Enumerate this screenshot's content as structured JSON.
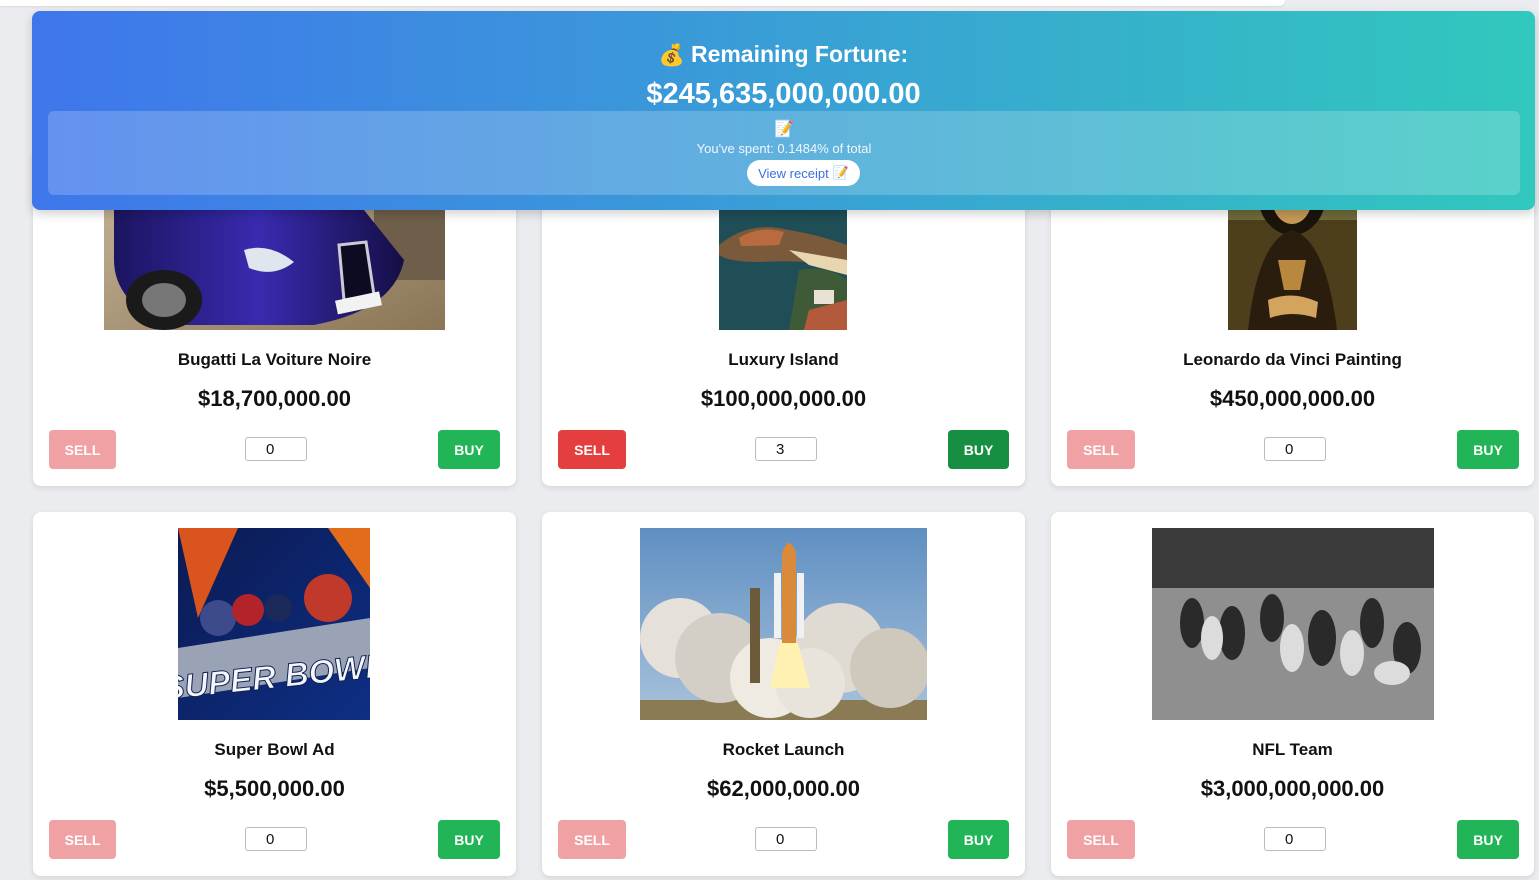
{
  "fortune": {
    "icon": "money-bag-icon",
    "title": "Remaining Fortune:",
    "amount": "$245,635,000,000.00",
    "spent_text": "You've spent: 0.1484% of total",
    "receipt_label": "View receipt"
  },
  "items": [
    {
      "name": "Bugatti La Voiture Noire",
      "price": "$18,700,000.00",
      "quantity": "0",
      "sell_label": "SELL",
      "buy_label": "BUY",
      "image": "bugatti-photo"
    },
    {
      "name": "Luxury Island",
      "price": "$100,000,000.00",
      "quantity": "3",
      "sell_label": "SELL",
      "buy_label": "BUY",
      "image": "island-photo"
    },
    {
      "name": "Leonardo da Vinci Painting",
      "price": "$450,000,000.00",
      "quantity": "0",
      "sell_label": "SELL",
      "buy_label": "BUY",
      "image": "mona-lisa-photo"
    },
    {
      "name": "Super Bowl Ad",
      "price": "$5,500,000.00",
      "quantity": "0",
      "sell_label": "SELL",
      "buy_label": "BUY",
      "image": "super-bowl-photo",
      "logo_text": "SUPER BOWL"
    },
    {
      "name": "Rocket Launch",
      "price": "$62,000,000.00",
      "quantity": "0",
      "sell_label": "SELL",
      "buy_label": "BUY",
      "image": "rocket-photo"
    },
    {
      "name": "NFL Team",
      "price": "$3,000,000,000.00",
      "quantity": "0",
      "sell_label": "SELL",
      "buy_label": "BUY",
      "image": "football-photo"
    }
  ]
}
